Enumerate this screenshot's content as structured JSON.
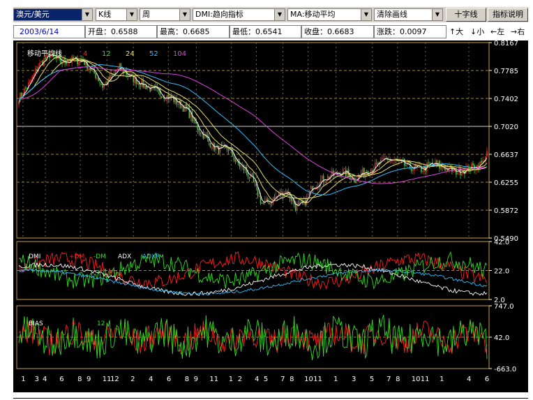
{
  "toolbar": {
    "symbol": "澳元/美元",
    "chart_kind": "K线",
    "period": "周",
    "indicator": "DMI:趋向指标",
    "ma": "MA:移动平均",
    "draw": "清除画线",
    "crosshair_button": "十字线",
    "help_button": "指标说明"
  },
  "quote": {
    "date": "2003/6/14",
    "open": "开盘：0.6588",
    "high": "最高：0.6685",
    "low": "最低：0.6541",
    "close": "收盘：0.6683",
    "change": "涨跌：0.0097"
  },
  "nav": {
    "zoom_in": "↑大",
    "zoom_out": "↓小",
    "left": "←左",
    "right": "→右"
  },
  "colors": {
    "background": "#000000",
    "panel_border": "#c8a048",
    "up_candle": "#ff2020",
    "down_candle": "#30e020",
    "ma1": "#ffffff",
    "ma2": "#e8e070",
    "ma3": "#30c0ff",
    "ma4": "#e040e0",
    "plus_dm": "#ff2020",
    "minus_dm": "#30e020",
    "adx": "#ffffff",
    "adxr": "#30c0ff"
  },
  "chart_data": [
    {
      "type": "candlestick",
      "title": "移动平均线",
      "legend": [
        {
          "name": "4",
          "color": "#ff2020"
        },
        {
          "name": "12",
          "color": "#30e020"
        },
        {
          "name": "24",
          "color": "#e8e070"
        },
        {
          "name": "52",
          "color": "#30c0ff"
        },
        {
          "name": "104",
          "color": "#e040e0"
        }
      ],
      "y_ticks": [
        "0.8167",
        "0.7785",
        "0.7402",
        "0.7020",
        "0.6637",
        "0.6255",
        "0.5872",
        "0.5490"
      ],
      "ylim": [
        0.549,
        0.8167
      ],
      "anchors_close": [
        [
          0,
          0.74
        ],
        [
          8,
          0.762
        ],
        [
          14,
          0.785
        ],
        [
          22,
          0.8
        ],
        [
          30,
          0.79
        ],
        [
          38,
          0.793
        ],
        [
          46,
          0.792
        ],
        [
          52,
          0.779
        ],
        [
          56,
          0.77
        ],
        [
          60,
          0.757
        ],
        [
          66,
          0.768
        ],
        [
          72,
          0.782
        ],
        [
          80,
          0.77
        ],
        [
          90,
          0.758
        ],
        [
          100,
          0.748
        ],
        [
          110,
          0.74
        ],
        [
          120,
          0.725
        ],
        [
          128,
          0.7
        ],
        [
          136,
          0.681
        ],
        [
          142,
          0.67
        ],
        [
          150,
          0.672
        ],
        [
          156,
          0.652
        ],
        [
          162,
          0.642
        ],
        [
          168,
          0.625
        ],
        [
          174,
          0.596
        ],
        [
          180,
          0.6
        ],
        [
          186,
          0.608
        ],
        [
          192,
          0.614
        ],
        [
          198,
          0.592
        ],
        [
          204,
          0.595
        ],
        [
          210,
          0.62
        ],
        [
          216,
          0.628
        ],
        [
          224,
          0.635
        ],
        [
          232,
          0.64
        ],
        [
          240,
          0.63
        ],
        [
          248,
          0.64
        ],
        [
          256,
          0.648
        ],
        [
          264,
          0.658
        ],
        [
          272,
          0.652
        ],
        [
          280,
          0.646
        ],
        [
          288,
          0.643
        ],
        [
          296,
          0.65
        ],
        [
          304,
          0.646
        ],
        [
          312,
          0.64
        ],
        [
          320,
          0.643
        ],
        [
          328,
          0.648
        ],
        [
          332,
          0.652
        ],
        [
          335,
          0.6683
        ]
      ],
      "sample_moving_averages": {
        "4": [
          [
            0,
            0.741
          ],
          [
            60,
            0.775
          ],
          [
            130,
            0.71
          ],
          [
            175,
            0.6
          ],
          [
            210,
            0.63
          ],
          [
            335,
            0.65
          ]
        ],
        "12": [
          [
            0,
            0.741
          ],
          [
            70,
            0.775
          ],
          [
            140,
            0.69
          ],
          [
            190,
            0.61
          ],
          [
            240,
            0.64
          ],
          [
            335,
            0.646
          ]
        ],
        "24": [
          [
            0,
            0.741
          ],
          [
            80,
            0.775
          ],
          [
            150,
            0.69
          ],
          [
            200,
            0.618
          ],
          [
            260,
            0.646
          ],
          [
            335,
            0.646
          ]
        ],
        "52": [
          [
            0,
            0.741
          ],
          [
            90,
            0.77
          ],
          [
            170,
            0.68
          ],
          [
            230,
            0.63
          ],
          [
            335,
            0.645
          ]
        ],
        "104": [
          [
            0,
            0.74
          ],
          [
            40,
            0.758
          ],
          [
            110,
            0.77
          ],
          [
            180,
            0.712
          ],
          [
            250,
            0.668
          ],
          [
            335,
            0.652
          ]
        ]
      }
    },
    {
      "type": "line",
      "title": "DMI",
      "legend": [
        {
          "name": "+DM",
          "color": "#ff2020"
        },
        {
          "name": "-DM",
          "color": "#30e020"
        },
        {
          "name": "ADX",
          "color": "#ffffff"
        },
        {
          "name": "ADXR",
          "color": "#30c0ff"
        }
      ],
      "y_ticks": [
        "42.0",
        "22.0",
        "2.0"
      ],
      "ylim": [
        2.0,
        42.0
      ]
    },
    {
      "type": "line",
      "title": "BIAS",
      "legend": [
        {
          "name": "6",
          "color": "#ff2020"
        },
        {
          "name": "12",
          "color": "#30e020"
        }
      ],
      "y_ticks": [
        "747.0",
        "42.0",
        "-663.0"
      ],
      "ylim": [
        -663.0,
        747.0
      ]
    }
  ],
  "x_ticks": [
    {
      "label": "1",
      "bar": 4
    },
    {
      "label": "3",
      "bar": 16
    },
    {
      "label": "4",
      "bar": 23
    },
    {
      "label": "6",
      "bar": 38
    },
    {
      "label": "8",
      "bar": 54
    },
    {
      "label": "9",
      "bar": 62
    },
    {
      "label": "11",
      "bar": 78
    },
    {
      "label": "12",
      "bar": 85
    },
    {
      "label": "2",
      "bar": 101
    },
    {
      "label": "4",
      "bar": 117
    },
    {
      "label": "6",
      "bar": 133
    },
    {
      "label": "8",
      "bar": 149
    },
    {
      "label": "9",
      "bar": 157
    },
    {
      "label": "11",
      "bar": 173
    },
    {
      "label": "1",
      "bar": 188
    },
    {
      "label": "2",
      "bar": 196
    },
    {
      "label": "4",
      "bar": 211
    },
    {
      "label": "5",
      "bar": 219
    },
    {
      "label": "7",
      "bar": 234
    },
    {
      "label": "8",
      "bar": 242
    },
    {
      "label": "10",
      "bar": 257
    },
    {
      "label": "11",
      "bar": 265
    },
    {
      "label": "1",
      "bar": 281
    },
    {
      "label": "3",
      "bar": 297
    },
    {
      "label": "5",
      "bar": 313
    },
    {
      "label": "7",
      "bar": 328
    },
    {
      "label": "8",
      "bar": 336
    },
    {
      "label": "10",
      "bar": 352
    },
    {
      "label": "11",
      "bar": 360
    },
    {
      "label": "1",
      "bar": 375
    },
    {
      "label": "4",
      "bar": 399
    },
    {
      "label": "6",
      "bar": 415
    }
  ]
}
